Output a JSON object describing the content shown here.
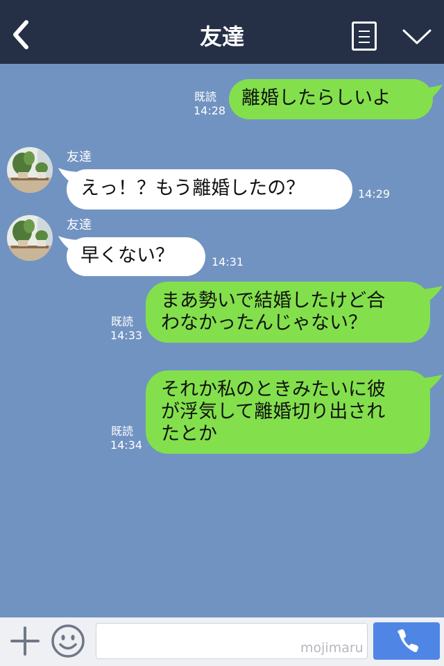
{
  "header": {
    "title": "友達",
    "back_icon": "chevron-left-icon",
    "menu_icon": "list-icon",
    "more_icon": "chevron-down-icon"
  },
  "messages": [
    {
      "side": "right",
      "text": "離婚したらしいよ",
      "read": "既読",
      "time": "14:28"
    },
    {
      "side": "left",
      "sender": "友達",
      "text": "えっ！？もう離婚したの？",
      "time": "14:29"
    },
    {
      "side": "left",
      "sender": "友達",
      "text": "早くない？",
      "time": "14:31"
    },
    {
      "side": "right",
      "lines": [
        "まあ勢いで結婚したけど合",
        "わなかったんじゃない？"
      ],
      "read": "既読",
      "time": "14:33"
    },
    {
      "side": "right",
      "lines": [
        "それか私のときみたいに彼",
        "が浮気して離婚切り出され",
        "たとか"
      ],
      "read": "既読",
      "time": "14:34"
    }
  ],
  "input_bar": {
    "plus_icon": "plus-icon",
    "emoji_icon": "smiley-icon",
    "text": "",
    "watermark": "mojimaru",
    "call_icon": "phone-icon"
  },
  "colors": {
    "header": "#253046",
    "background": "#7193c1",
    "right_bubble": "#83e04c",
    "left_bubble": "#ffffff",
    "call_button": "#4f86e6"
  }
}
